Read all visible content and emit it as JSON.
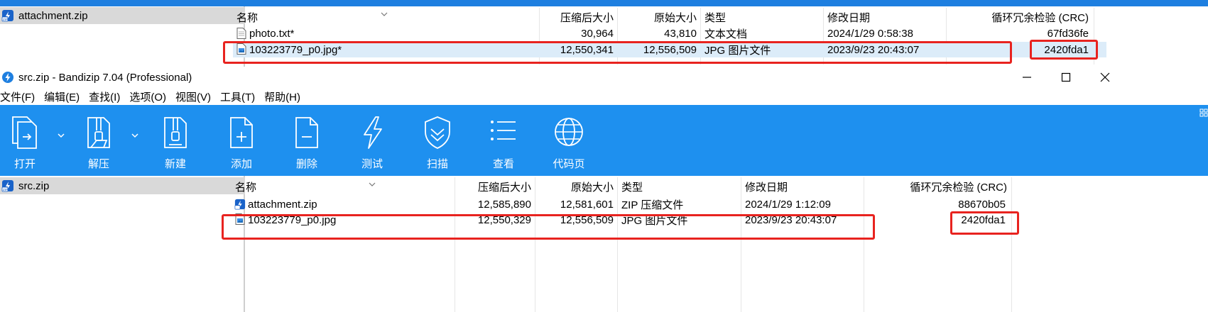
{
  "top_window": {
    "tree_item": "attachment.zip",
    "columns": [
      "名称",
      "压缩后大小",
      "原始大小",
      "类型",
      "修改日期",
      "循环冗余检验 (CRC)"
    ],
    "rows": [
      {
        "name": "photo.txt*",
        "packed": "30,964",
        "size": "43,810",
        "type": "文本文档",
        "modified": "2024/1/29 0:58:38",
        "crc": "67fd36fe",
        "icon": "text-file-icon"
      },
      {
        "name": "103223779_p0.jpg*",
        "packed": "12,550,341",
        "size": "12,556,509",
        "type": "JPG 图片文件",
        "modified": "2023/9/23 20:43:07",
        "crc": "2420fda1",
        "icon": "image-file-icon"
      }
    ]
  },
  "main_window": {
    "title": "src.zip - Bandizip 7.04 (Professional)",
    "menu": [
      "文件(F)",
      "编辑(E)",
      "查找(I)",
      "选项(O)",
      "视图(V)",
      "工具(T)",
      "帮助(H)"
    ],
    "toolbar": [
      {
        "label": "打开",
        "icon": "open-icon"
      },
      {
        "label": "解压",
        "icon": "extract-icon"
      },
      {
        "label": "新建",
        "icon": "new-archive-icon"
      },
      {
        "label": "添加",
        "icon": "add-file-icon"
      },
      {
        "label": "删除",
        "icon": "delete-file-icon"
      },
      {
        "label": "测试",
        "icon": "test-icon"
      },
      {
        "label": "扫描",
        "icon": "scan-shield-icon"
      },
      {
        "label": "查看",
        "icon": "view-list-icon"
      },
      {
        "label": "代码页",
        "icon": "codepage-globe-icon"
      }
    ],
    "tree_item": "src.zip",
    "columns": [
      "名称",
      "压缩后大小",
      "原始大小",
      "类型",
      "修改日期",
      "循环冗余检验 (CRC)"
    ],
    "rows": [
      {
        "name": "attachment.zip",
        "packed": "12,585,890",
        "size": "12,581,601",
        "type": "ZIP 压缩文件",
        "modified": "2024/1/29 1:12:09",
        "crc": "88670b05",
        "icon": "zip-file-icon"
      },
      {
        "name": "103223779_p0.jpg",
        "packed": "12,550,329",
        "size": "12,556,509",
        "type": "JPG 图片文件",
        "modified": "2023/9/23 20:43:07",
        "crc": "2420fda1",
        "icon": "image-file-icon"
      }
    ]
  },
  "colors": {
    "toolbar_blue": "#1e90ef",
    "highlight_red": "#e8231f",
    "selection": "#d9d9d9"
  }
}
